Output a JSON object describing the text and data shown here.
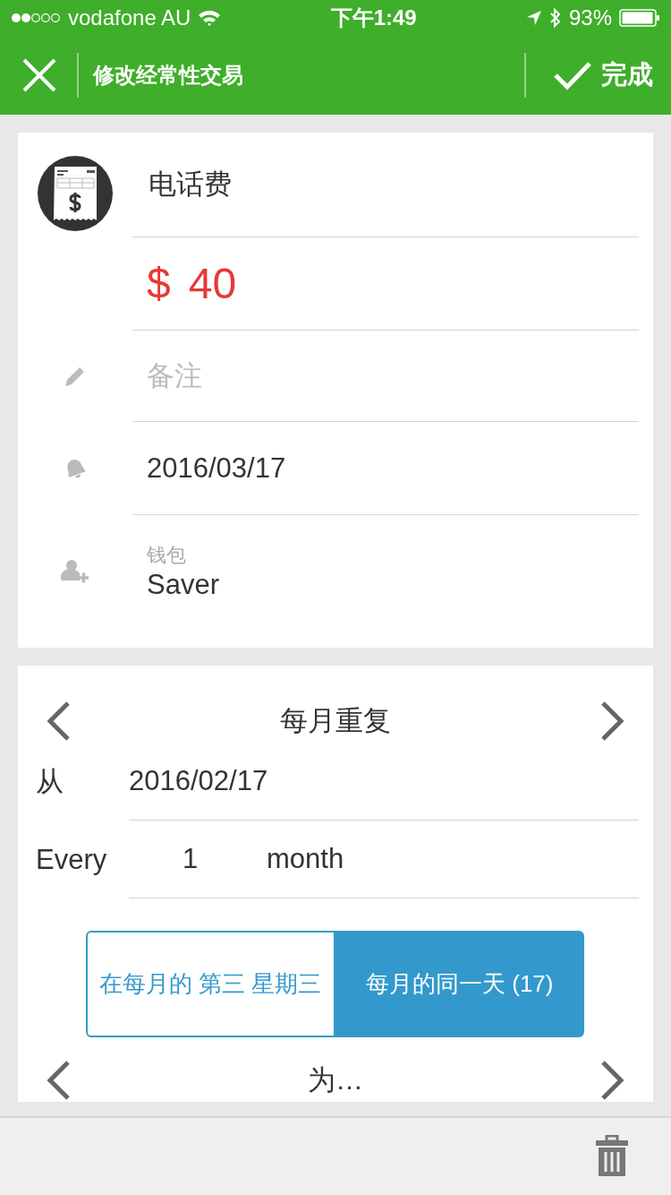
{
  "status_bar": {
    "carrier": "vodafone AU",
    "time": "下午1:49",
    "battery": "93%"
  },
  "nav_bar": {
    "title": "修改经常性交易",
    "done": "完成"
  },
  "form": [
    {
      "kind": "name",
      "value": "电话费"
    },
    {
      "kind": "amount",
      "currency": "$",
      "value": "40"
    },
    {
      "kind": "note",
      "placeholder": "备注"
    },
    {
      "kind": "date",
      "value": "2016/03/17"
    },
    {
      "kind": "wallet",
      "label": "钱包",
      "value": "Saver"
    }
  ],
  "repeat": {
    "title": "每月重复",
    "from_label": "从",
    "from_value": "2016/02/17",
    "every_label": "Every",
    "every_count": "1",
    "every_unit": "month",
    "options": [
      {
        "label": "在每月的 第三 星期三",
        "selected": false
      },
      {
        "label": "每月的同一天 (17)",
        "selected": true
      }
    ],
    "for_label": "为…"
  }
}
